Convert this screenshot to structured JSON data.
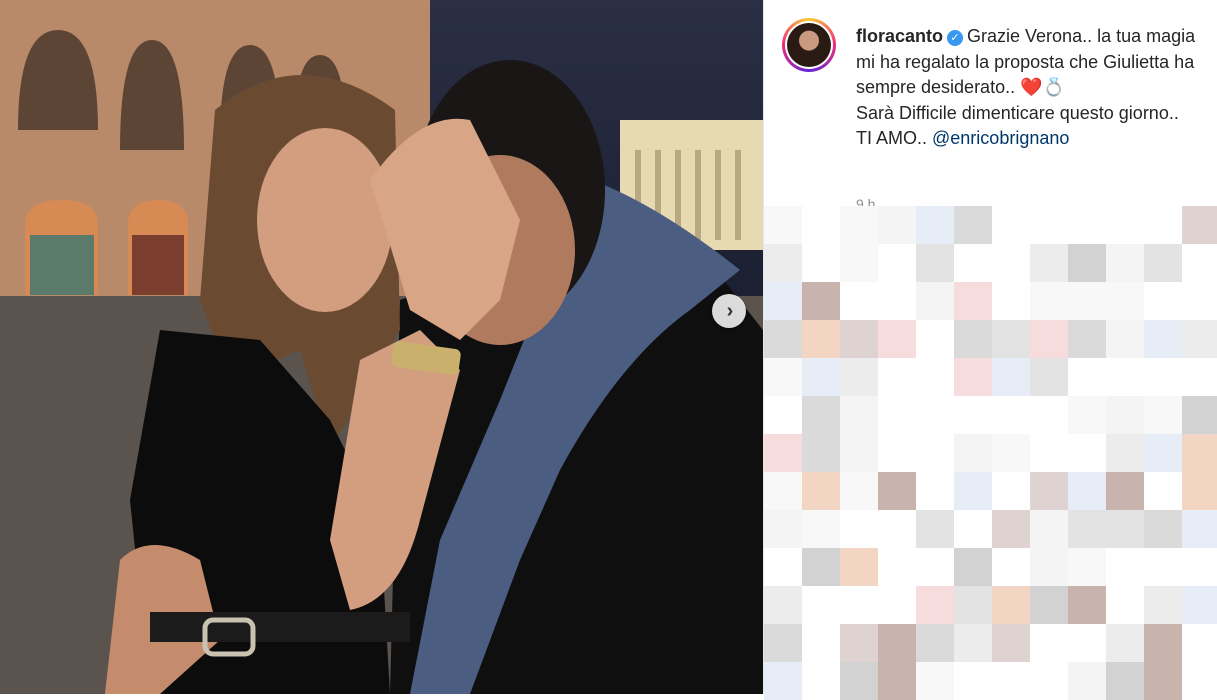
{
  "post": {
    "username": "floracanto",
    "verified_icon": "verified-badge-icon",
    "caption_line1": "Grazie Verona.. la tua magia mi ha regalato la proposta che Giulietta ha sempre desiderato.. ",
    "caption_emoji_heart": "❤️",
    "caption_emoji_ring": "💍",
    "caption_line2": "Sarà Difficile dimenticare questo giorno..",
    "caption_line3_prefix": "TI AMO.. ",
    "mention": "@enricobrignano",
    "time_ago": "9 h",
    "next_icon": "chevron-right-icon"
  },
  "colors": {
    "mention": "#00376b",
    "verified": "#3897f0",
    "text": "#262626"
  }
}
